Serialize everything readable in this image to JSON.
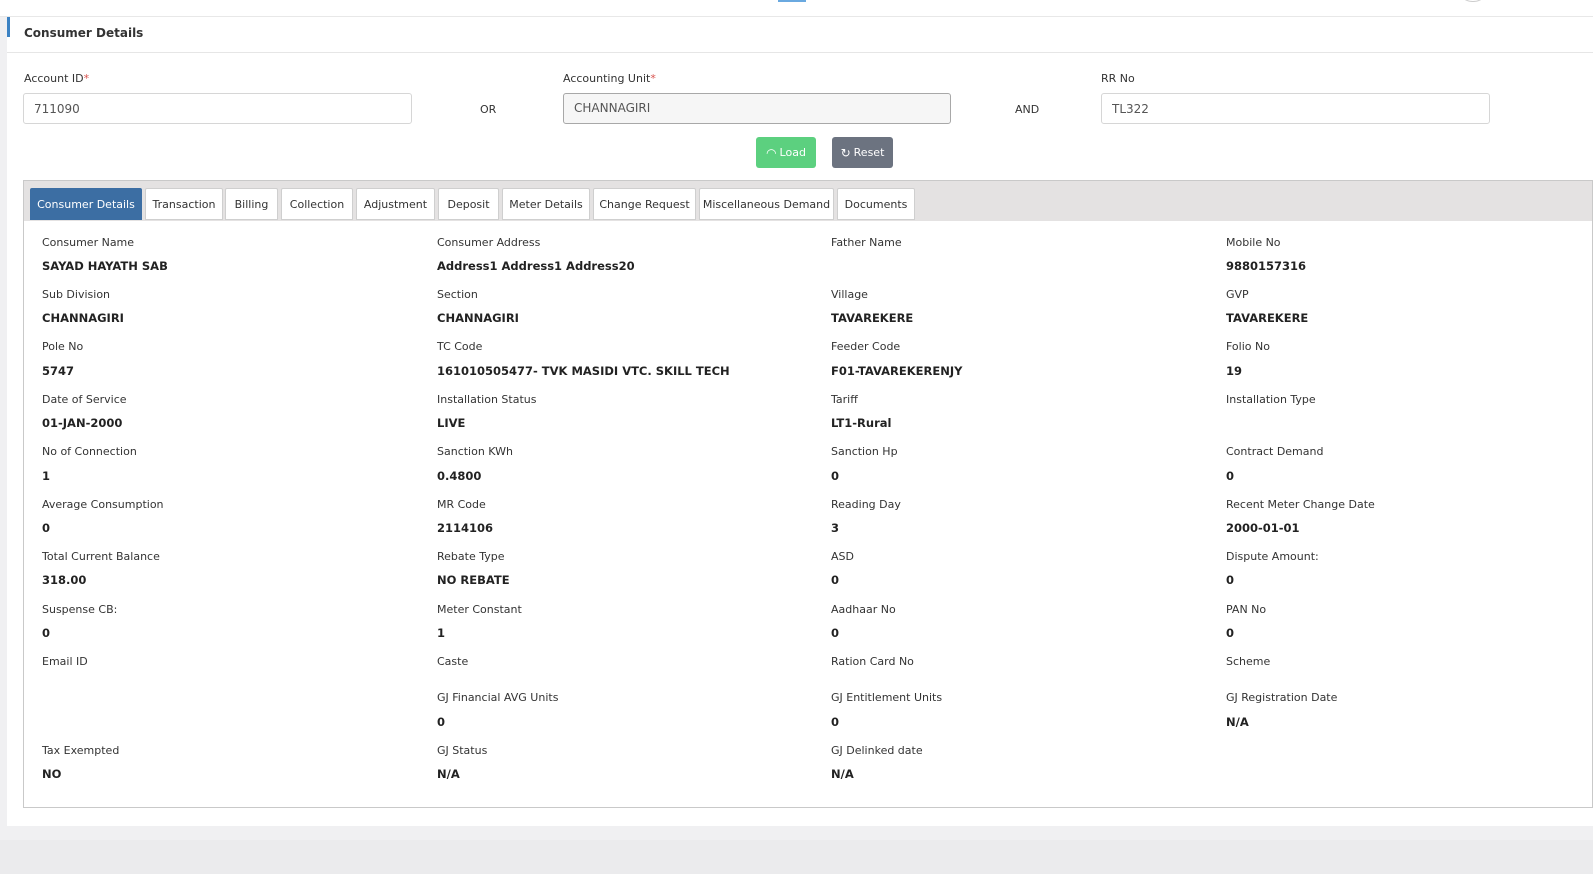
{
  "panel": {
    "title": "Consumer Details"
  },
  "search": {
    "account_id": {
      "label": "Account ID",
      "required": "*",
      "value": "711090"
    },
    "or_label": "OR",
    "accounting_unit": {
      "label": "Accounting Unit",
      "required": "*",
      "value": "CHANNAGIRI"
    },
    "and_label": "AND",
    "rr_no": {
      "label": "RR No",
      "value": "TL322"
    },
    "load_label": "Load",
    "reset_label": "Reset"
  },
  "tabs": [
    {
      "label": "Consumer Details",
      "active": true
    },
    {
      "label": "Transaction"
    },
    {
      "label": "Billing"
    },
    {
      "label": "Collection"
    },
    {
      "label": "Adjustment"
    },
    {
      "label": "Deposit"
    },
    {
      "label": "Meter Details"
    },
    {
      "label": "Change Request"
    },
    {
      "label": "Miscellaneous Demand"
    },
    {
      "label": "Documents"
    }
  ],
  "fields": [
    {
      "label": "Consumer Name",
      "value": "SAYAD HAYATH SAB"
    },
    {
      "label": "Consumer Address",
      "value": "Address1 Address1 Address20"
    },
    {
      "label": "Father Name",
      "value": ""
    },
    {
      "label": "Mobile No",
      "value": "9880157316"
    },
    {
      "label": "Sub Division",
      "value": "CHANNAGIRI"
    },
    {
      "label": "Section",
      "value": "CHANNAGIRI"
    },
    {
      "label": "Village",
      "value": "TAVAREKERE"
    },
    {
      "label": "GVP",
      "value": "TAVAREKERE"
    },
    {
      "label": "Pole No",
      "value": "5747"
    },
    {
      "label": "TC Code",
      "value": "161010505477- TVK MASIDI VTC. SKILL TECH"
    },
    {
      "label": "Feeder Code",
      "value": "F01-TAVAREKERENJY"
    },
    {
      "label": "Folio No",
      "value": "19"
    },
    {
      "label": "Date of Service",
      "value": "01-JAN-2000"
    },
    {
      "label": "Installation Status",
      "value": "LIVE"
    },
    {
      "label": "Tariff",
      "value": "LT1-Rural"
    },
    {
      "label": "Installation Type",
      "value": ""
    },
    {
      "label": "No of Connection",
      "value": "1"
    },
    {
      "label": "Sanction KWh",
      "value": "0.4800"
    },
    {
      "label": "Sanction Hp",
      "value": "0"
    },
    {
      "label": "Contract Demand",
      "value": "0"
    },
    {
      "label": "Average Consumption",
      "value": "0"
    },
    {
      "label": "MR Code",
      "value": "2114106"
    },
    {
      "label": "Reading Day",
      "value": "3"
    },
    {
      "label": "Recent Meter Change Date",
      "value": "2000-01-01"
    },
    {
      "label": "Total Current Balance",
      "value": "318.00"
    },
    {
      "label": "Rebate Type",
      "value": "NO REBATE"
    },
    {
      "label": "ASD",
      "value": "0"
    },
    {
      "label": "Dispute Amount:",
      "value": "0"
    },
    {
      "label": "Suspense CB:",
      "value": "0"
    },
    {
      "label": "Meter Constant",
      "value": "1"
    },
    {
      "label": "Aadhaar No",
      "value": "0"
    },
    {
      "label": "PAN No",
      "value": "0"
    },
    {
      "label": "Email ID",
      "value": ""
    },
    {
      "label": "Caste",
      "value": ""
    },
    {
      "label": "Ration Card No",
      "value": ""
    },
    {
      "label": "Scheme",
      "value": ""
    },
    {
      "label": "GJ Financial AVG Units",
      "value": "0"
    },
    {
      "label": "GJ Entitlement Units",
      "value": "0"
    },
    {
      "label": "GJ Registration Date",
      "value": "N/A"
    },
    {
      "label": "Tax Exempted",
      "value": "NO"
    },
    {
      "label": "GJ Status",
      "value": "N/A"
    },
    {
      "label": "GJ Delinked date",
      "value": "N/A"
    }
  ]
}
